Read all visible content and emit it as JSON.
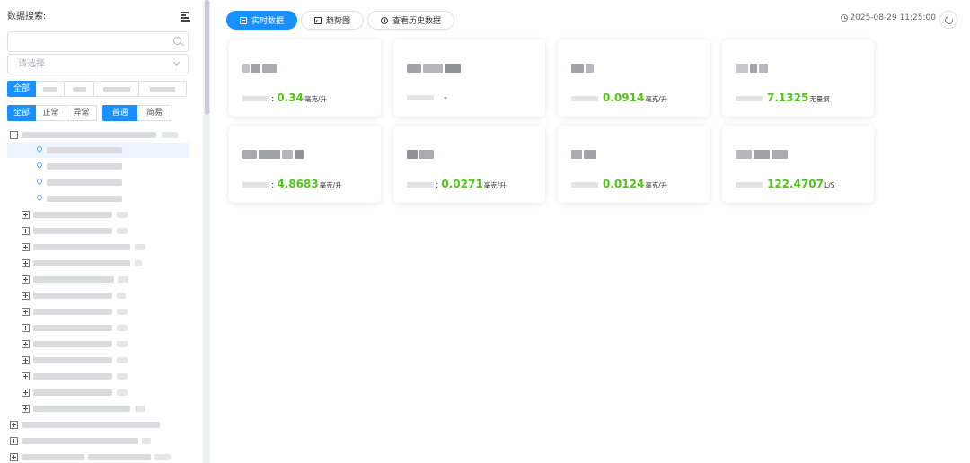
{
  "sidebar": {
    "title": "数据搜索:",
    "search": {
      "value": "",
      "placeholder": ""
    },
    "select": {
      "placeholder": "请选择"
    },
    "filter_type": {
      "selected_label": "全部"
    },
    "filter_status": {
      "items": [
        {
          "label": "全部",
          "active": true
        },
        {
          "label": "正常",
          "active": false
        },
        {
          "label": "异常",
          "active": false
        }
      ]
    },
    "view_mode": {
      "items": [
        {
          "label": "普通",
          "active": true
        },
        {
          "label": "简易",
          "active": false
        }
      ]
    }
  },
  "header": {
    "tabs": [
      {
        "label": "实时数据",
        "active": true,
        "icon": "doc-icon"
      },
      {
        "label": "趋势图",
        "active": false,
        "icon": "trend-icon"
      },
      {
        "label": "查看历史数据",
        "active": false,
        "icon": "clock-icon"
      }
    ],
    "timestamp": "2025-08-29 11:25:00"
  },
  "cards": [
    {
      "colon": ":",
      "value": "0.34",
      "unit": "毫克/升"
    },
    {
      "colon": "",
      "value": "-",
      "unit": ""
    },
    {
      "colon": "",
      "value": "0.0914",
      "unit": "毫克/升"
    },
    {
      "colon": "",
      "value": "7.1325",
      "unit": "无量纲"
    },
    {
      "colon": ":",
      "value": "4.8683",
      "unit": "毫克/升"
    },
    {
      "colon": ":",
      "value": "0.0271",
      "unit": "毫克/升"
    },
    {
      "colon": "",
      "value": "0.0124",
      "unit": "毫克/升"
    },
    {
      "colon": "",
      "value": "122.4707",
      "unit": "L/S"
    }
  ],
  "colors": {
    "accent": "#1890ff",
    "value_green": "#52c41a"
  }
}
